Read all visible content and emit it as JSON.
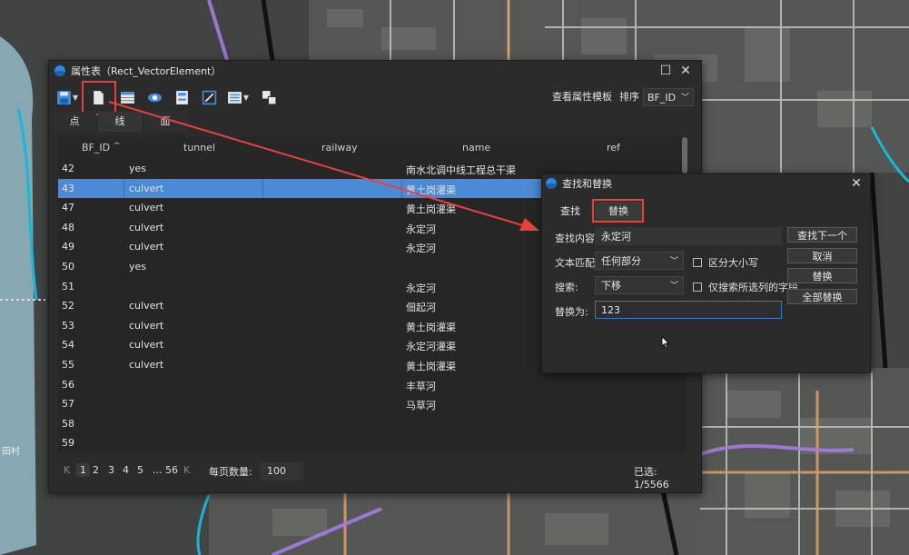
{
  "attr_window": {
    "title": "属性表（Rect_VectorElement）",
    "toolbar_icons": [
      "save-icon",
      "dropdown-icon",
      "new-file-icon",
      "table-icon",
      "eye-icon",
      "save-disk-icon",
      "edit-frame-icon",
      "list-icon",
      "dropdown-icon",
      "copy-icon"
    ],
    "template_button": "查看属性模板",
    "sort_label": "排序",
    "sort_value": "BF_ID",
    "geo_tabs": [
      "点",
      "线",
      "面"
    ],
    "columns": [
      "BF_ID",
      "tunnel",
      "railway",
      "name",
      "ref"
    ],
    "rows": [
      {
        "id": "42",
        "tunnel": "yes",
        "name": "南水北调中线工程总干渠"
      },
      {
        "id": "43",
        "tunnel": "culvert",
        "name": "黄土岗灌渠",
        "selected": true
      },
      {
        "id": "47",
        "tunnel": "culvert",
        "name": "黄土岗灌渠"
      },
      {
        "id": "48",
        "tunnel": "culvert",
        "name": "永定河"
      },
      {
        "id": "49",
        "tunnel": "culvert",
        "name": "永定河"
      },
      {
        "id": "50",
        "tunnel": "yes",
        "name": ""
      },
      {
        "id": "51",
        "tunnel": "",
        "name": "永定河"
      },
      {
        "id": "52",
        "tunnel": "culvert",
        "name": "佃起河"
      },
      {
        "id": "53",
        "tunnel": "culvert",
        "name": "黄土岗灌渠"
      },
      {
        "id": "54",
        "tunnel": "culvert",
        "name": "永定河灌渠"
      },
      {
        "id": "55",
        "tunnel": "culvert",
        "name": "黄土岗灌渠"
      },
      {
        "id": "56",
        "tunnel": "",
        "name": "丰草河"
      },
      {
        "id": "57",
        "tunnel": "",
        "name": "马草河"
      },
      {
        "id": "58",
        "tunnel": "",
        "name": ""
      },
      {
        "id": "59",
        "tunnel": "",
        "name": ""
      }
    ],
    "pager": {
      "first": "K",
      "pages": [
        "1",
        "2",
        "3",
        "4",
        "5",
        "...",
        "56"
      ],
      "last": "K",
      "page_size_label": "每页数量:",
      "page_size": "100",
      "selected": "已选: 1/5566"
    }
  },
  "find_dialog": {
    "title": "查找和替换",
    "tabs": [
      "查找",
      "替换"
    ],
    "find_label": "查找内容:",
    "find_value": "永定河",
    "match_label": "文本匹配:",
    "match_value": "任何部分",
    "search_label": "搜索:",
    "search_value": "下移",
    "replace_label": "替换为:",
    "replace_value": "123",
    "case_label": "区分大小写",
    "selected_only_label": "仅搜索所选列的字段",
    "buttons": [
      "查找下一个",
      "取消",
      "替换",
      "全部替换"
    ]
  },
  "map_labels": {
    "village": "田村"
  },
  "colors": {
    "highlight": "#e8413c",
    "selection": "#4b8ad6",
    "accent": "#2f86e6"
  }
}
